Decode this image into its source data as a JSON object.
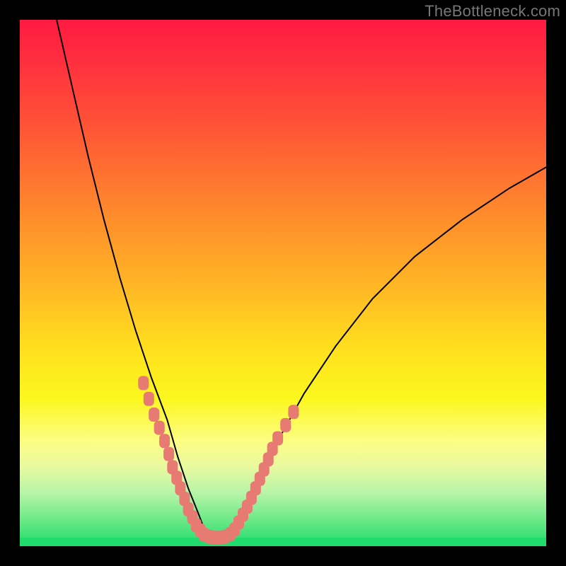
{
  "watermark": "TheBottleneck.com",
  "chart_data": {
    "type": "line",
    "title": "",
    "xlabel": "",
    "ylabel": "",
    "xlim": [
      0,
      100
    ],
    "ylim": [
      0,
      100
    ],
    "grid": false,
    "background_gradient": [
      "#ff1b41",
      "#ff7e2e",
      "#ffe11e",
      "#fdfd84",
      "#1fdc6c"
    ],
    "series": [
      {
        "name": "black-curve-left",
        "x": [
          7,
          10,
          13,
          16,
          19,
          22,
          25,
          28,
          30,
          32,
          34,
          35.5
        ],
        "y": [
          100,
          87,
          74,
          62,
          51,
          41,
          32,
          24,
          17,
          11,
          6,
          2
        ]
      },
      {
        "name": "black-curve-right",
        "x": [
          40,
          42,
          45,
          49,
          54,
          60,
          67,
          75,
          84,
          93,
          100
        ],
        "y": [
          2,
          6,
          12,
          20,
          29,
          38,
          47,
          55,
          62,
          68,
          72
        ]
      },
      {
        "name": "green-floor",
        "x": [
          0,
          100
        ],
        "y": [
          0,
          0
        ]
      }
    ],
    "highlighted_points": {
      "name": "salmon-nubs",
      "color": "#e77a72",
      "points": [
        {
          "x": 23.5,
          "y": 31
        },
        {
          "x": 24.5,
          "y": 28
        },
        {
          "x": 25.5,
          "y": 25
        },
        {
          "x": 26.5,
          "y": 22.5
        },
        {
          "x": 27.5,
          "y": 20
        },
        {
          "x": 28.3,
          "y": 17.5
        },
        {
          "x": 29.0,
          "y": 15
        },
        {
          "x": 29.8,
          "y": 13
        },
        {
          "x": 30.5,
          "y": 11
        },
        {
          "x": 31.3,
          "y": 9
        },
        {
          "x": 32.0,
          "y": 7
        },
        {
          "x": 32.8,
          "y": 5.5
        },
        {
          "x": 33.5,
          "y": 4
        },
        {
          "x": 34.3,
          "y": 3
        },
        {
          "x": 35.0,
          "y": 2.2
        },
        {
          "x": 36.0,
          "y": 1.8
        },
        {
          "x": 37.0,
          "y": 1.6
        },
        {
          "x": 38.0,
          "y": 1.6
        },
        {
          "x": 39.0,
          "y": 1.8
        },
        {
          "x": 40.0,
          "y": 2.3
        },
        {
          "x": 40.8,
          "y": 3.2
        },
        {
          "x": 41.6,
          "y": 4.5
        },
        {
          "x": 42.4,
          "y": 6
        },
        {
          "x": 43.2,
          "y": 7.5
        },
        {
          "x": 44.0,
          "y": 9.2
        },
        {
          "x": 44.8,
          "y": 11
        },
        {
          "x": 45.6,
          "y": 12.8
        },
        {
          "x": 46.4,
          "y": 14.6
        },
        {
          "x": 47.2,
          "y": 16.5
        },
        {
          "x": 48.0,
          "y": 18.5
        },
        {
          "x": 49.0,
          "y": 20.5
        },
        {
          "x": 50.5,
          "y": 23
        },
        {
          "x": 52.0,
          "y": 25.5
        }
      ]
    }
  }
}
